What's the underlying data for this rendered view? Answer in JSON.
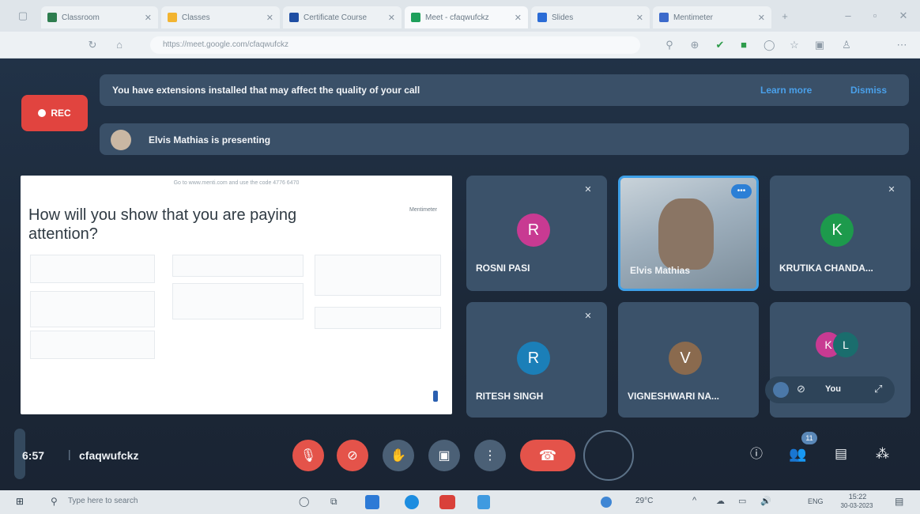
{
  "browser": {
    "tabs": [
      {
        "label": "Classroom",
        "color": "#2e7d4f"
      },
      {
        "label": "Classes",
        "color": "#f2b431"
      },
      {
        "label": "Certificate Course",
        "color": "#1f4ea3"
      },
      {
        "label": "Meet - cfaqwufckz",
        "color": "#1e9f5b"
      },
      {
        "label": "Slides",
        "color": "#2b6cd6"
      },
      {
        "label": "Mentimeter",
        "color": "#3c6acb"
      }
    ],
    "url": "https://meet.google.com/cfaqwufckz"
  },
  "meet": {
    "rec_label": "REC",
    "extensions_banner": "You have extensions installed that may affect the quality of your call",
    "learn_more": "Learn more",
    "dismiss": "Dismiss",
    "presenting_banner": "Elvis Mathias is presenting",
    "slide": {
      "header": "Go to www.menti.com and use the code 4776 6470",
      "question": "How will you show that you are paying attention?",
      "brand": "Mentimeter"
    },
    "tiles": [
      {
        "name": "ROSNI PASI",
        "initial": "R",
        "color": "#c83a92"
      },
      {
        "name": "Elvis Mathias",
        "initial": "",
        "color": ""
      },
      {
        "name": "KRUTIKA CHANDA...",
        "initial": "K",
        "color": "#1d9a4c"
      },
      {
        "name": "RITESH SINGH",
        "initial": "R",
        "color": "#1b7fb8"
      },
      {
        "name": "VIGNESHWARI NA...",
        "initial": "V",
        "color": "#8a6a4e"
      },
      {
        "name": "",
        "initial": "",
        "color": ""
      }
    ],
    "extra_avatars": [
      "K",
      "L"
    ],
    "self_label": "You",
    "time": "6:57",
    "meeting_code": "cfaqwufckz",
    "participants_count": "11"
  },
  "taskbar": {
    "search_placeholder": "Type here to search",
    "temperature": "29°C",
    "language": "ENG",
    "clock_time": "15:22",
    "clock_date": "30-03-2023"
  }
}
